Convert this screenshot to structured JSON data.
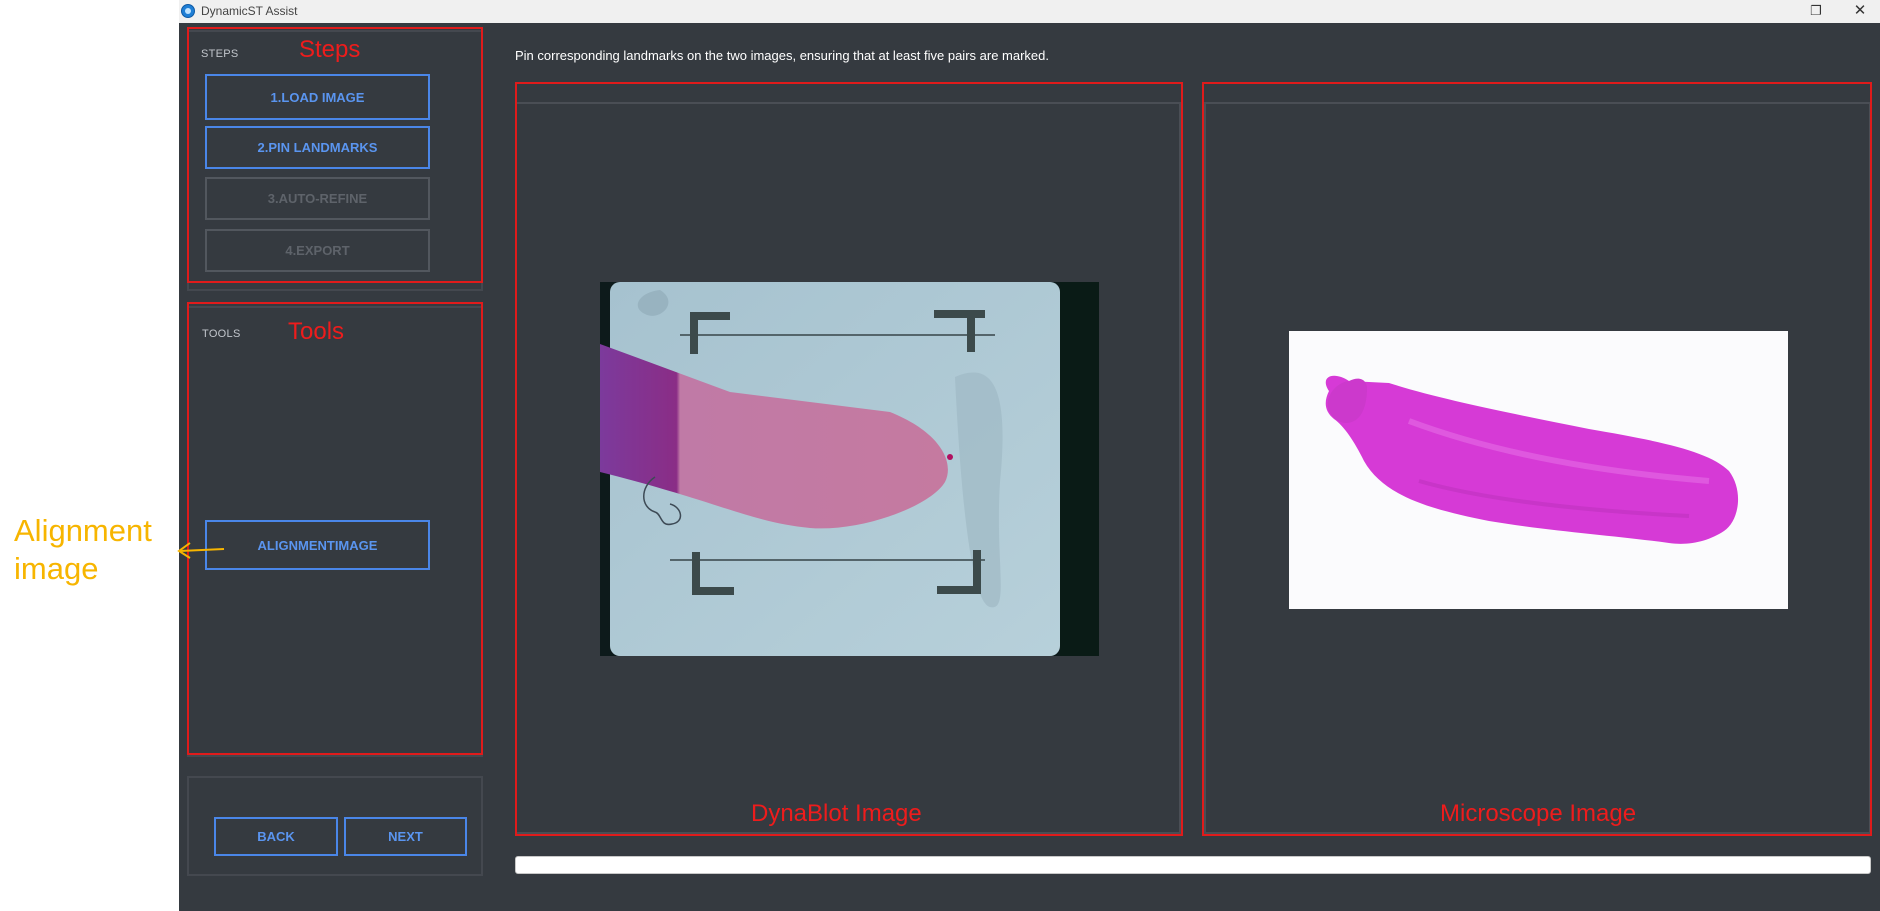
{
  "window": {
    "title": "DynamicST Assist",
    "restore_glyph": "❐",
    "close_glyph": "✕"
  },
  "steps": {
    "label": "STEPS",
    "buttons": [
      {
        "label": "1.LOAD IMAGE",
        "enabled": true
      },
      {
        "label": "2.PIN LANDMARKS",
        "enabled": true
      },
      {
        "label": "3.AUTO-REFINE",
        "enabled": false
      },
      {
        "label": "4.EXPORT",
        "enabled": false
      }
    ]
  },
  "tools": {
    "label": "TOOLS",
    "alignment_button": "ALIGNMENTIMAGE"
  },
  "nav": {
    "back": "BACK",
    "next": "NEXT"
  },
  "instruction": "Pin corresponding landmarks on the two images, ensuring that at least five pairs are marked.",
  "panels": {
    "left_caption": "DynaBlot Image",
    "right_caption": "Microscope Image"
  },
  "annotations": {
    "steps": "Steps",
    "tools": "Tools",
    "alignment": "Alignment image"
  },
  "progress": {
    "fraction": 0.0
  },
  "colors": {
    "accent": "#4a86e8",
    "annotation_red": "#e01b1b",
    "annotation_orange": "#f7b500",
    "background": "#353a40"
  }
}
